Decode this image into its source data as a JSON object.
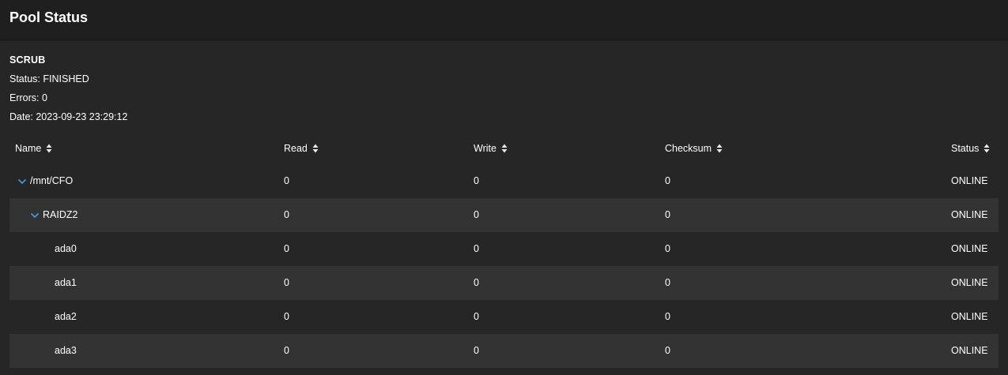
{
  "header": {
    "title": "Pool Status"
  },
  "scrub": {
    "heading": "SCRUB",
    "status": "Status: FINISHED",
    "errors": "Errors: 0",
    "date": "Date: 2023-09-23 23:29:12"
  },
  "table": {
    "columns": [
      {
        "label": "Name"
      },
      {
        "label": "Read"
      },
      {
        "label": "Write"
      },
      {
        "label": "Checksum"
      },
      {
        "label": "Status"
      }
    ],
    "rows": [
      {
        "name": "/mnt/CFO",
        "read": "0",
        "write": "0",
        "checksum": "0",
        "status": "ONLINE",
        "level": 0,
        "expandable": true
      },
      {
        "name": "RAIDZ2",
        "read": "0",
        "write": "0",
        "checksum": "0",
        "status": "ONLINE",
        "level": 1,
        "expandable": true
      },
      {
        "name": "ada0",
        "read": "0",
        "write": "0",
        "checksum": "0",
        "status": "ONLINE",
        "level": 2,
        "expandable": false
      },
      {
        "name": "ada1",
        "read": "0",
        "write": "0",
        "checksum": "0",
        "status": "ONLINE",
        "level": 2,
        "expandable": false
      },
      {
        "name": "ada2",
        "read": "0",
        "write": "0",
        "checksum": "0",
        "status": "ONLINE",
        "level": 2,
        "expandable": false
      },
      {
        "name": "ada3",
        "read": "0",
        "write": "0",
        "checksum": "0",
        "status": "ONLINE",
        "level": 2,
        "expandable": false
      }
    ]
  },
  "icons": {
    "sort": "sort-icon",
    "expand": "chevron-down-icon"
  },
  "colors": {
    "accent": "#3ba1e0",
    "background": "#262626",
    "header": "#1f1f1f",
    "row_alt": "#333333"
  }
}
